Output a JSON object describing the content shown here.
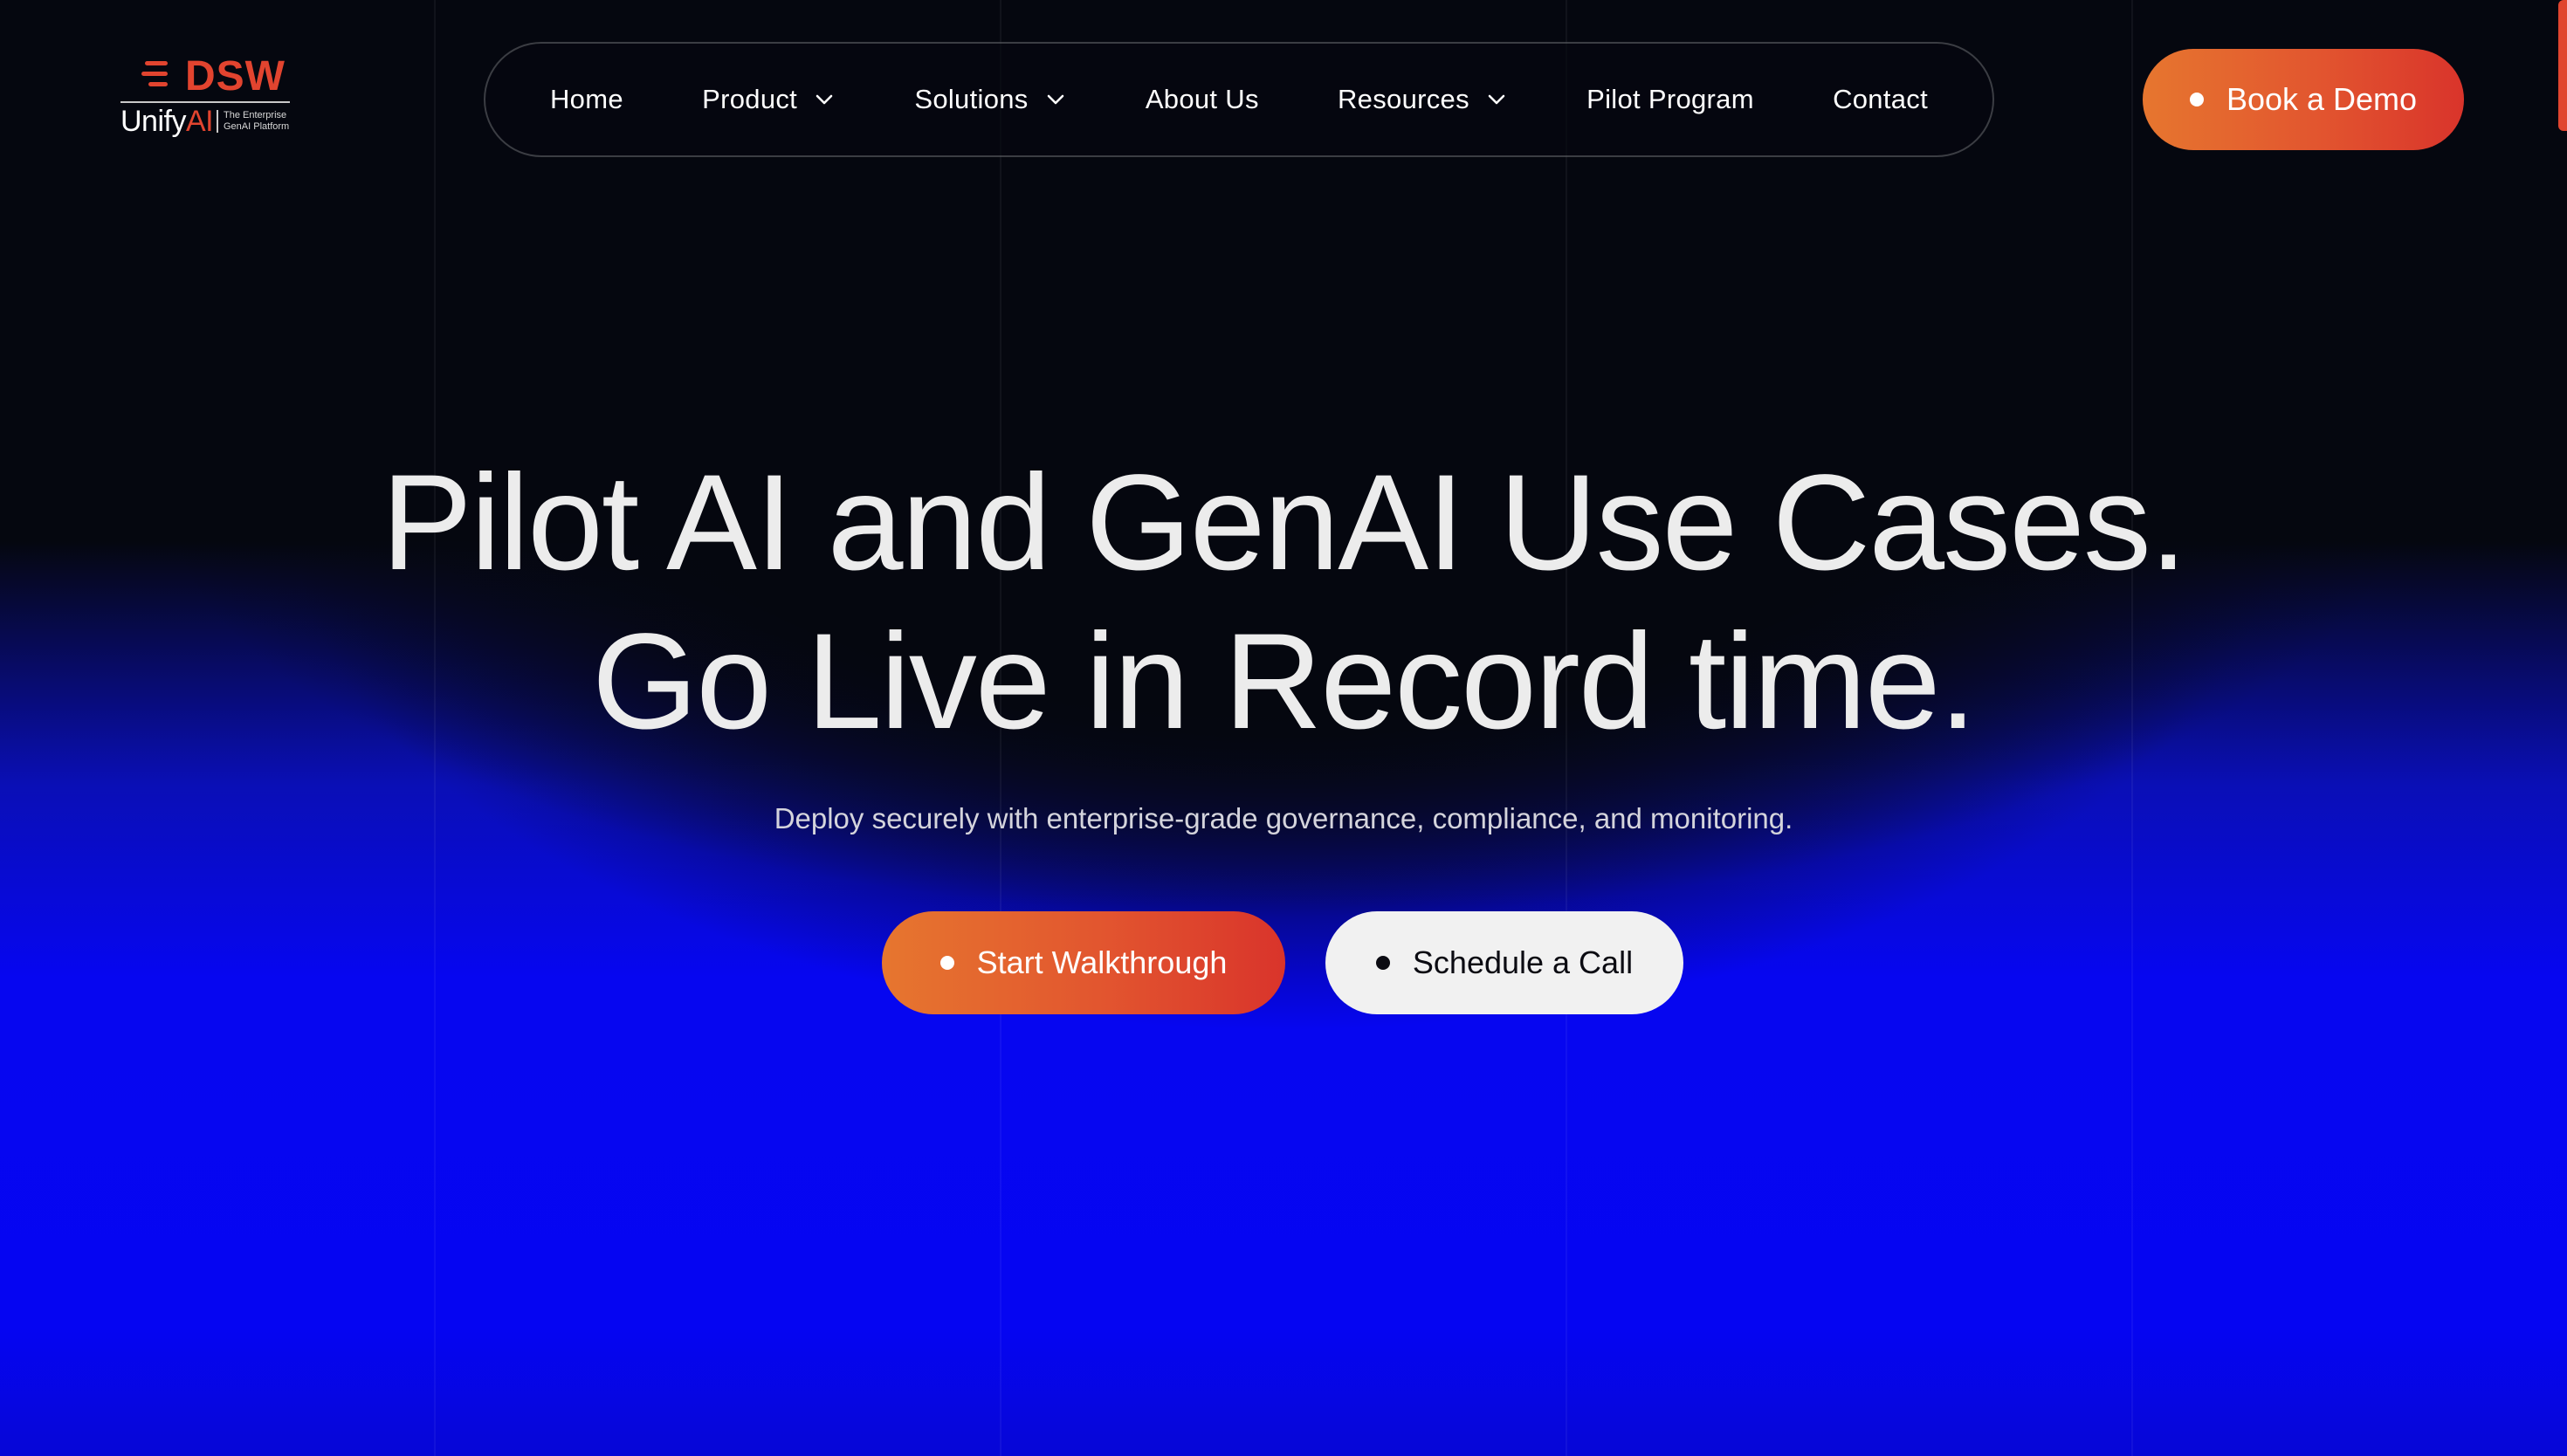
{
  "brand": {
    "logo_mark_text": "DSW",
    "product_name_prefix": "Unify",
    "product_name_suffix": "AI",
    "tagline": "The Enterprise GenAI Platform",
    "accent_color": "#e2442f"
  },
  "nav": {
    "items": [
      {
        "label": "Home",
        "has_dropdown": false
      },
      {
        "label": "Product",
        "has_dropdown": true
      },
      {
        "label": "Solutions",
        "has_dropdown": true
      },
      {
        "label": "About Us",
        "has_dropdown": false
      },
      {
        "label": "Resources",
        "has_dropdown": true
      },
      {
        "label": "Pilot Program",
        "has_dropdown": false
      },
      {
        "label": "Contact",
        "has_dropdown": false
      }
    ],
    "cta_label": "Book a Demo"
  },
  "hero": {
    "title_line1": "Pilot AI and GenAI Use Cases.",
    "title_line2": "Go Live in Record time.",
    "subtitle": "Deploy securely with enterprise-grade governance, compliance, and monitoring.",
    "primary_cta": "Start Walkthrough",
    "secondary_cta": "Schedule a Call"
  },
  "colors": {
    "background": "#05070f",
    "glow_blue": "#0505f2",
    "cta_gradient_start": "#e6762f",
    "cta_gradient_end": "#d9342b",
    "secondary_button": "#f1f1f1"
  }
}
